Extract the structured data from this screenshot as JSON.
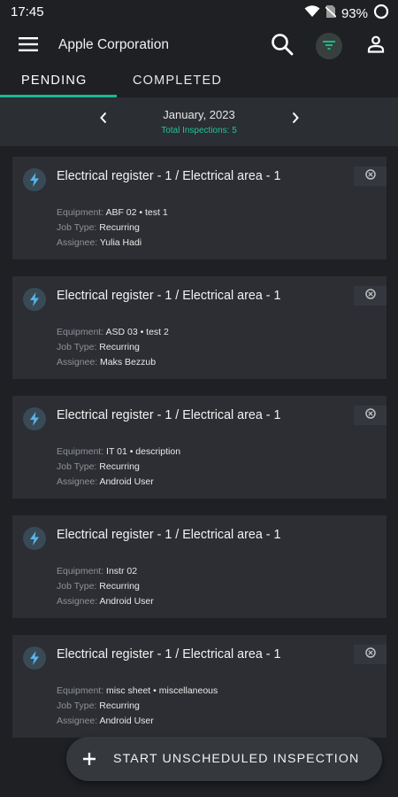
{
  "status_bar": {
    "time": "17:45",
    "battery": "93%"
  },
  "header": {
    "title": "Apple Corporation"
  },
  "tabs": [
    {
      "label": "PENDING"
    },
    {
      "label": "COMPLETED"
    }
  ],
  "period": {
    "month": "January, 2023",
    "total": "Total Inspections: 5"
  },
  "field_labels": {
    "equipment": "Equipment:",
    "job_type": "Job Type:",
    "assignee": "Assignee:"
  },
  "inspections": [
    {
      "title": "Electrical register - 1 / Electrical area - 1",
      "equipment": "ABF 02 • test 1",
      "job_type": "Recurring",
      "assignee": "Yulia Hadi"
    },
    {
      "title": "Electrical register - 1 / Electrical area - 1",
      "equipment": "ASD 03 • test 2",
      "job_type": "Recurring",
      "assignee": "Maks Bezzub"
    },
    {
      "title": "Electrical register - 1 / Electrical area - 1",
      "equipment": "IT 01 • description",
      "job_type": "Recurring",
      "assignee": "Android User"
    },
    {
      "title": "Electrical register - 1 / Electrical area - 1",
      "equipment": "Instr 02",
      "job_type": "Recurring",
      "assignee": "Android User"
    },
    {
      "title": "Electrical register - 1 / Electrical area - 1",
      "equipment": "misc sheet • miscellaneous",
      "job_type": "Recurring",
      "assignee": "Android User"
    }
  ],
  "fab": {
    "label": "START UNSCHEDULED INSPECTION"
  },
  "colors": {
    "accent": "#19b891",
    "background": "#1f2024",
    "card": "#2c2e33",
    "icon_bolt": "#5ab4e8"
  }
}
